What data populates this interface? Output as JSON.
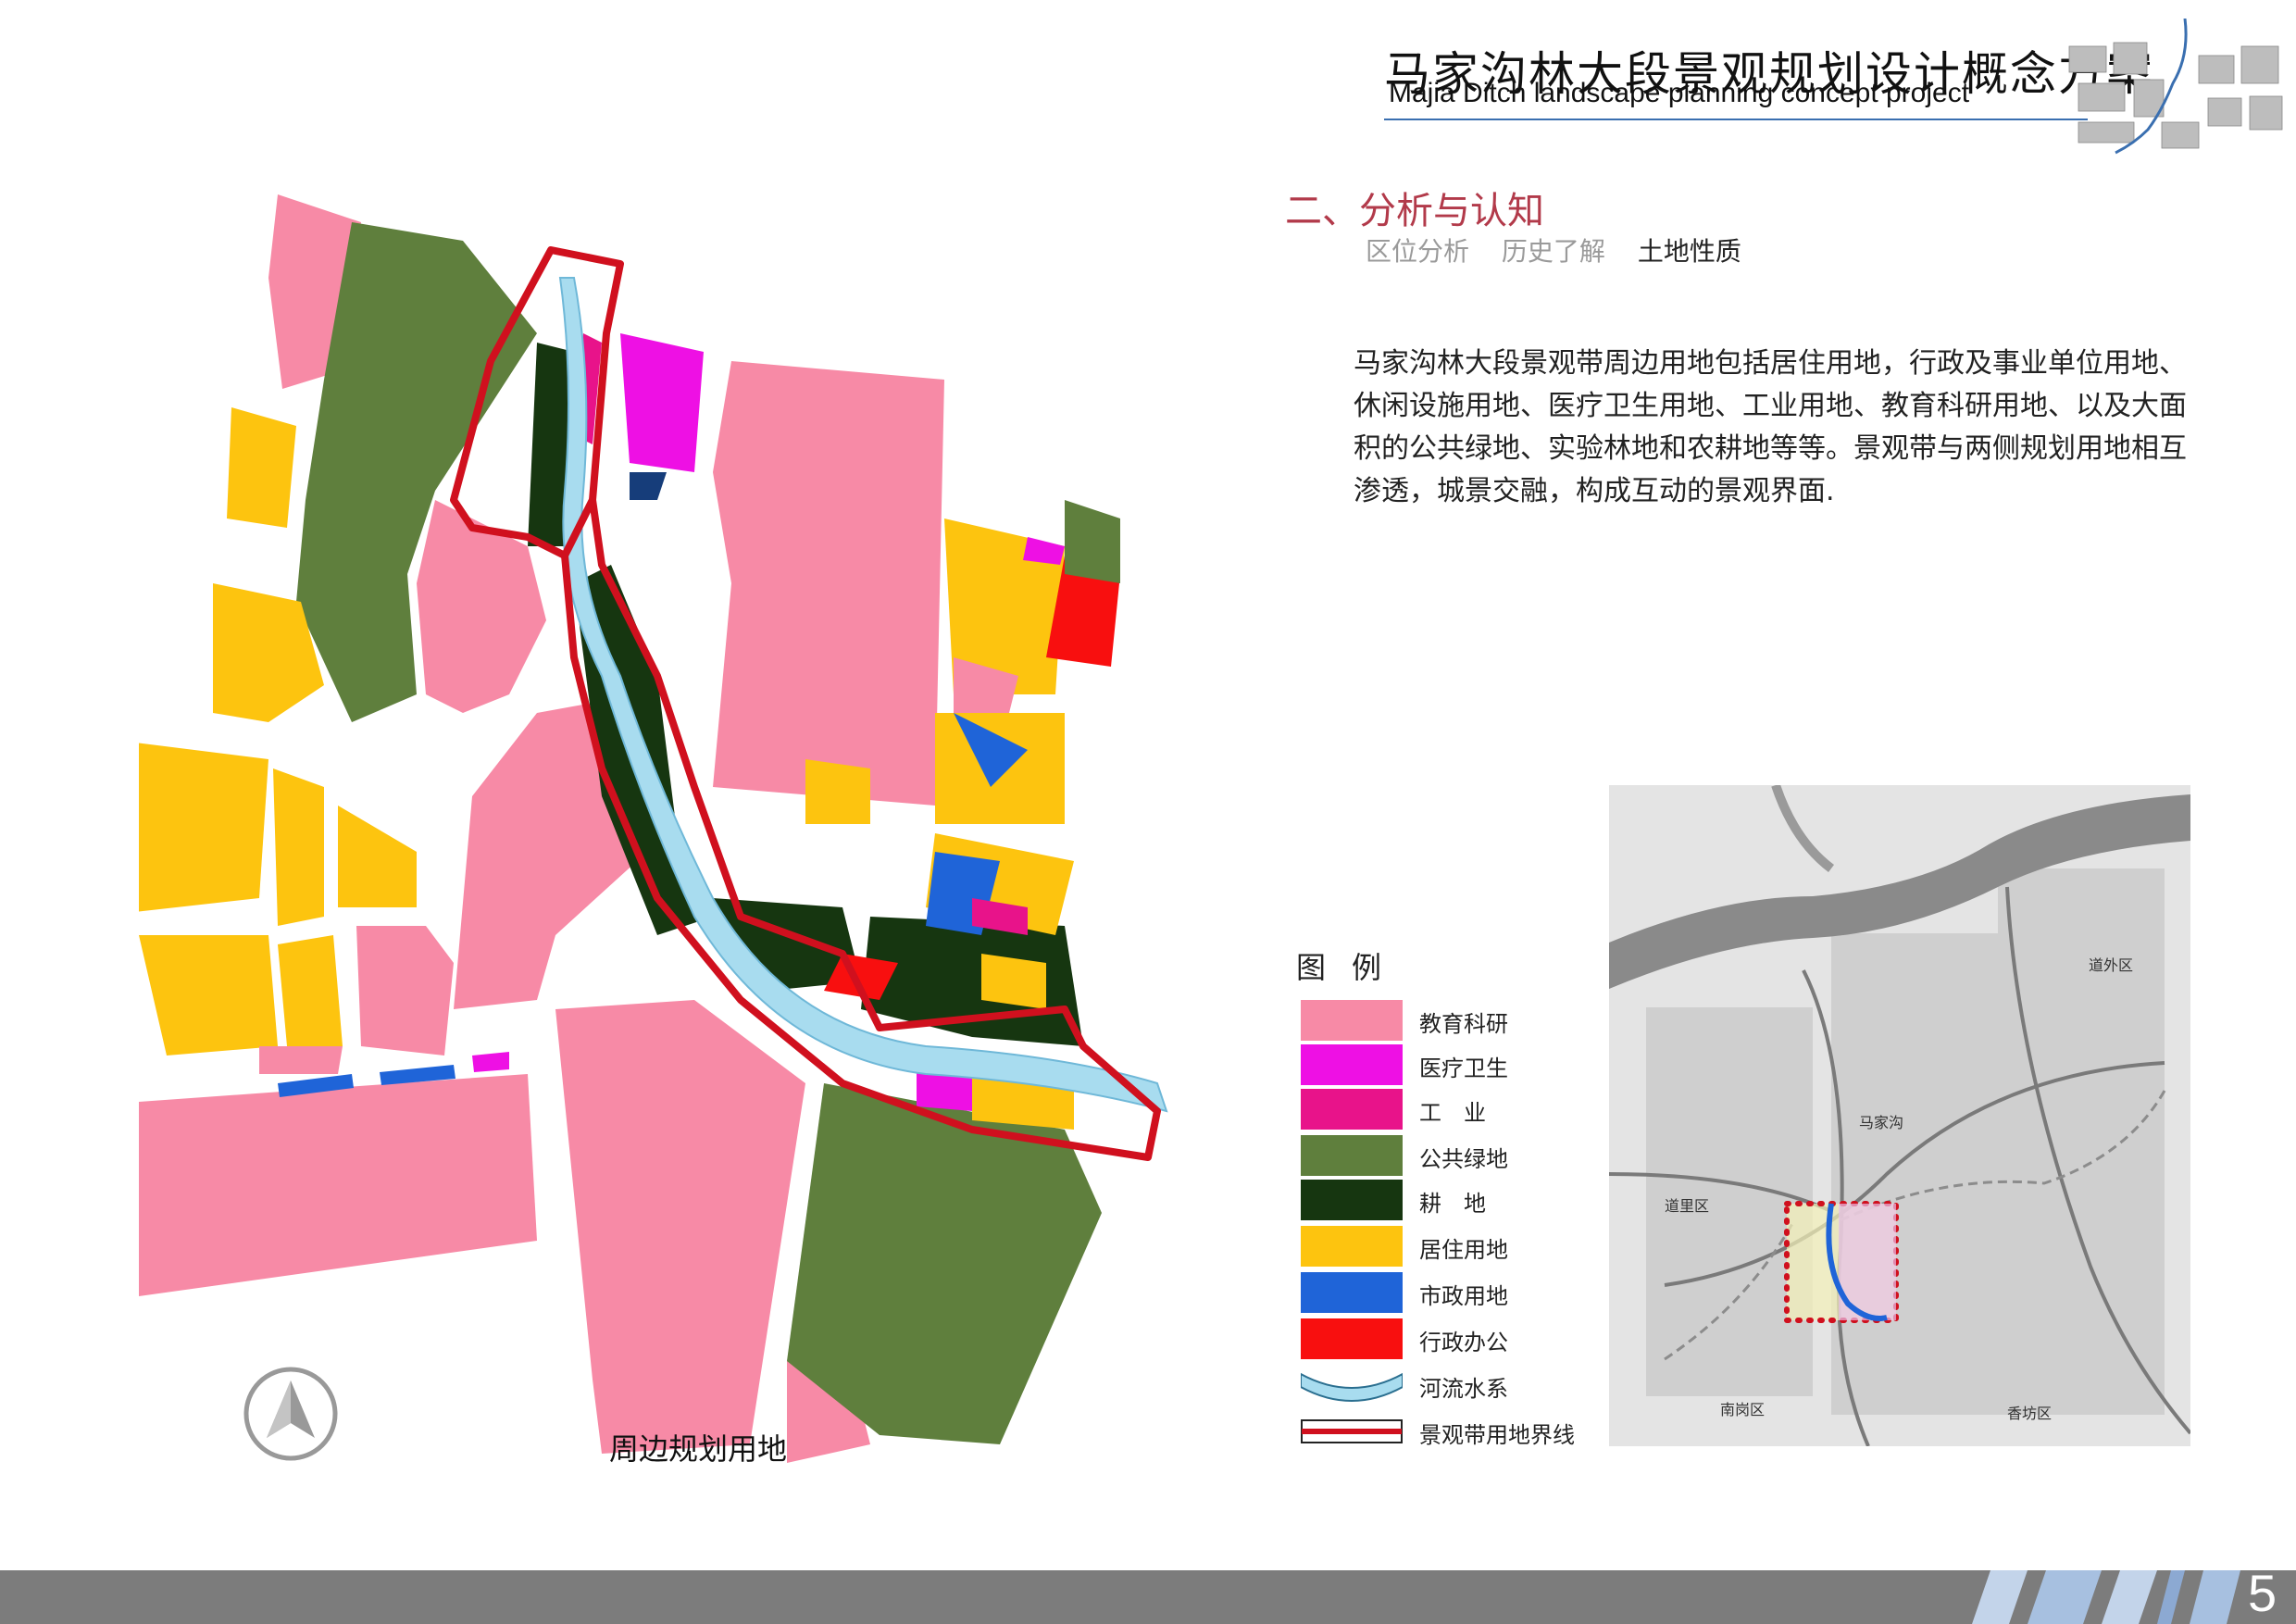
{
  "header": {
    "title_cn": "马家沟林大段景观规划设计概念方案",
    "title_en": "Majia Ditch landscape planning concept project"
  },
  "section": {
    "title": "二、分析与认知",
    "tabs": [
      {
        "label": "区位分析",
        "active": false
      },
      {
        "label": "历史了解",
        "active": false
      },
      {
        "label": "土地性质",
        "active": true
      }
    ]
  },
  "description": "马家沟林大段景观带周边用地包括居住用地，行政及事业单位用地、休闲设施用地、医疗卫生用地、工业用地、教育科研用地、以及大面积的公共绿地、实验林地和农耕地等等。景观带与两侧规划用地相互渗透，城景交融，构成互动的景观界面.",
  "map": {
    "label": "周边规划用地",
    "north_arrow_icon": "north-arrow-icon"
  },
  "legend": {
    "title": "图例",
    "items": [
      {
        "label": "教育科研",
        "color": "#f78aa6"
      },
      {
        "label": "医疗卫生",
        "color": "#ee10e4"
      },
      {
        "label": "工　业",
        "color": "#e8138a"
      },
      {
        "label": "公共绿地",
        "color": "#5f7f3d"
      },
      {
        "label": "耕　地",
        "color": "#163610"
      },
      {
        "label": "居住用地",
        "color": "#fdc40f"
      },
      {
        "label": "市政用地",
        "color": "#1f64d8"
      },
      {
        "label": "行政办公",
        "color": "#f80f0f"
      },
      {
        "label": "河流水系",
        "color": "#a8dcef"
      },
      {
        "label": "景观带用地界线",
        "color": "#d0101e"
      }
    ]
  },
  "locator_map": {
    "labels": [
      "道外区",
      "马家沟",
      "道里区",
      "南岗区",
      "香坊区"
    ]
  },
  "footer": {
    "page_number": "5"
  }
}
